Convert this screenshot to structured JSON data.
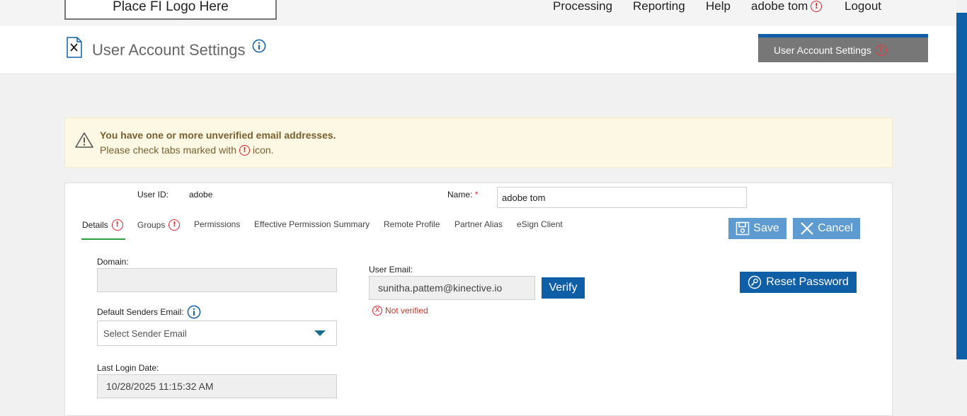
{
  "topnav": {
    "logo_text": "Place FI Logo Here",
    "items": [
      "Processing",
      "Reporting",
      "Help",
      "adobe tom",
      "Logout"
    ]
  },
  "header": {
    "title": "User Account Settings",
    "tab_button": "User Account Settings"
  },
  "warning": {
    "title": "You have one or more unverified email addresses.",
    "msg_before": "Please check tabs marked with",
    "msg_after": "icon."
  },
  "user": {
    "id_label": "User ID:",
    "id_value": "adobe",
    "name_label": "Name:",
    "required_mark": "*",
    "name_value": "adobe tom"
  },
  "tabs": [
    "Details",
    "Groups",
    "Permissions",
    "Effective Permission Summary",
    "Remote Profile",
    "Partner Alias",
    "eSign Client"
  ],
  "actions": {
    "save": "Save",
    "cancel": "Cancel",
    "reset_password": "Reset Password"
  },
  "form": {
    "domain_label": "Domain:",
    "domain_value": "",
    "user_email_label": "User Email:",
    "user_email_value": "sunitha.pattem@kinective.io",
    "verify": "Verify",
    "not_verified": "Not verified",
    "default_senders_label": "Default Senders Email:",
    "sender_placeholder": "Select Sender Email",
    "last_login_label": "Last Login Date:",
    "last_login_value": "10/28/2025 11:15:32 AM"
  },
  "colors": {
    "primary": "#0f5fa6",
    "button_light": "#5d9bd0",
    "alert": "#d8272f",
    "active_tab": "#2f9e3e",
    "warning_bg": "#fcf8e3"
  },
  "icons": {
    "alert": "!",
    "x": "X"
  }
}
